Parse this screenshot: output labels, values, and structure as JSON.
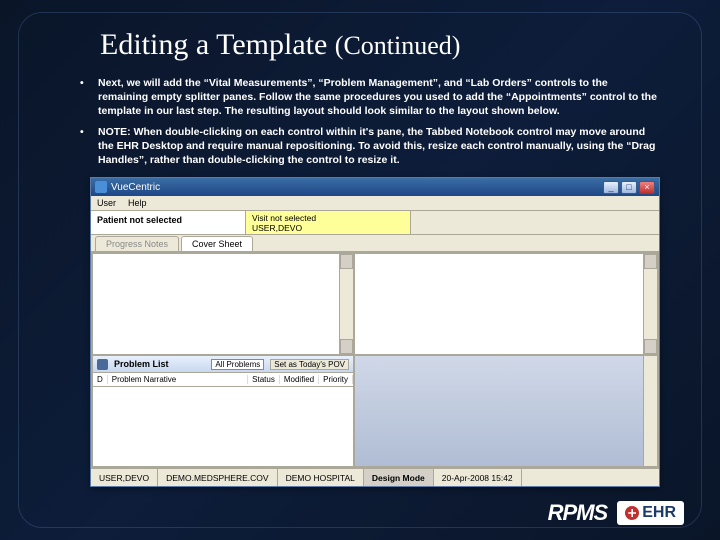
{
  "title_main": "Editing a Template ",
  "title_cont": "(Continued)",
  "bullets": [
    "Next, we will add the “Vital Measurements”, “Problem Management”, and “Lab Orders” controls to the remaining empty splitter panes.  Follow the same procedures you used to add the “Appointments” control to the template in our last step.  The resulting layout should look similar to the layout shown below.",
    "NOTE: When double-clicking on each control within it's pane, the Tabbed Notebook control may move around the EHR Desktop and require manual repositioning.  To avoid this, resize each control manually, using the “Drag Handles”, rather than double-clicking the control to resize it."
  ],
  "app": {
    "titlebar": "VueCentric",
    "menu": [
      "User",
      "Help"
    ],
    "patient_label": "Patient not selected",
    "visit_label": "Visit not selected",
    "visit_user": "USER,DEVO",
    "tabs": [
      "Progress Notes",
      "Cover Sheet"
    ],
    "problem": {
      "title": "Problem List",
      "selector": "All Problems",
      "button": "Set as Today's POV",
      "cols": [
        "D",
        "Problem Narrative",
        "Status",
        "Modified",
        "Priority"
      ]
    },
    "status": [
      "USER,DEVO",
      "DEMO.MEDSPHERE.COV",
      "DEMO HOSPITAL",
      "Design Mode",
      "20-Apr-2008 15:42"
    ]
  },
  "logos": {
    "rpms": "RPMS",
    "ehr": "EHR"
  }
}
